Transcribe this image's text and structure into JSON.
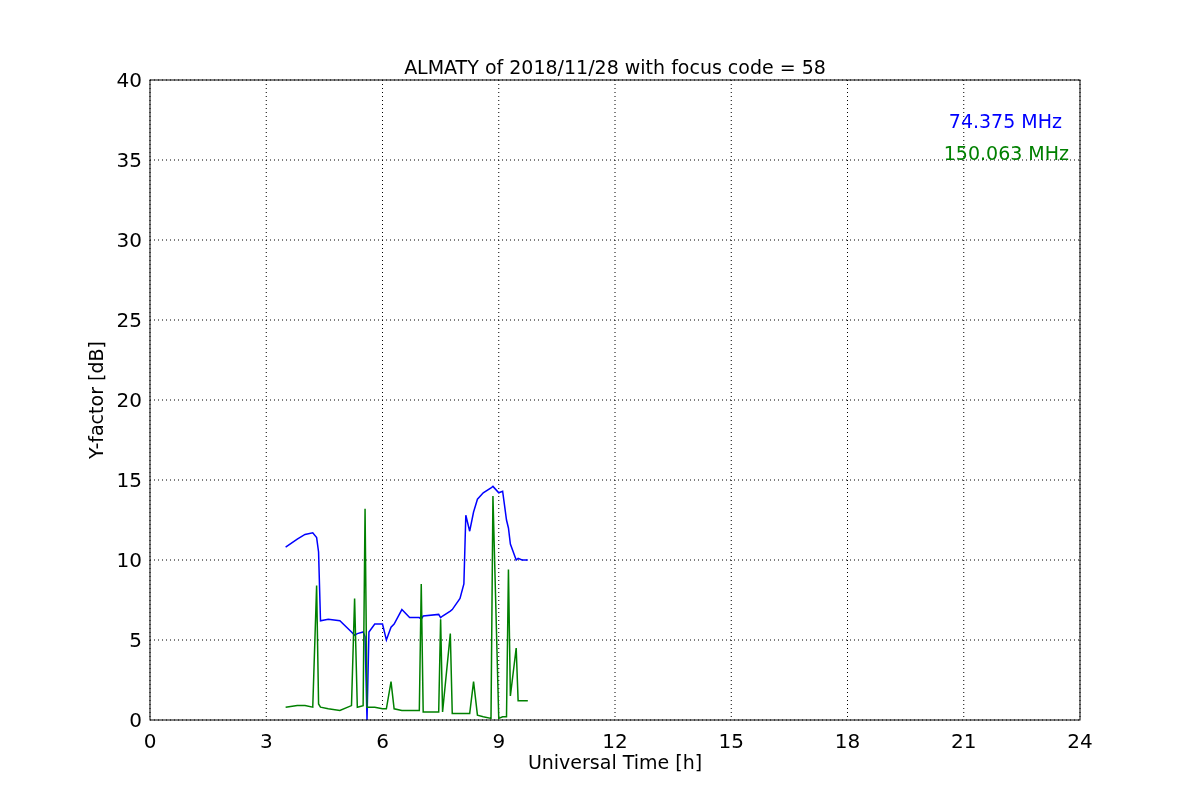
{
  "chart_data": {
    "type": "line",
    "title": "ALMATY of 2018/11/28 with focus code = 58",
    "xlabel": "Universal Time [h]",
    "ylabel": "Y-factor [dB]",
    "x": [
      3.5,
      3.8,
      4.0,
      4.2,
      4.3,
      4.35,
      4.4,
      4.6,
      4.9,
      5.2,
      5.28,
      5.35,
      5.5,
      5.55,
      5.6,
      5.65,
      5.8,
      6.0,
      6.1,
      6.22,
      6.3,
      6.5,
      6.7,
      6.95,
      7.0,
      7.05,
      7.45,
      7.5,
      7.55,
      7.75,
      7.8,
      8.0,
      8.1,
      8.15,
      8.25,
      8.35,
      8.45,
      8.6,
      8.8,
      8.85,
      9.0,
      9.1,
      9.2,
      9.25,
      9.3,
      9.45,
      9.5,
      9.6,
      9.75
    ],
    "series": [
      {
        "name": "74.375 MHz",
        "color": "#0000ff",
        "values": [
          10.8,
          11.3,
          11.6,
          11.7,
          11.4,
          10.5,
          6.2,
          6.3,
          6.2,
          5.5,
          5.3,
          5.4,
          5.5,
          5.2,
          0,
          5.5,
          6.0,
          6.0,
          5.0,
          5.8,
          6.0,
          6.9,
          6.4,
          6.4,
          6.3,
          6.5,
          6.6,
          6.4,
          6.5,
          6.8,
          6.9,
          7.6,
          8.5,
          12.8,
          11.8,
          13.0,
          13.8,
          14.2,
          14.5,
          14.6,
          14.2,
          14.3,
          12.5,
          12.0,
          11.0,
          10.0,
          10.1,
          10.0,
          10.0
        ]
      },
      {
        "name": "150.063 MHz",
        "color": "#008000",
        "values": [
          0.8,
          0.9,
          0.9,
          0.8,
          8.4,
          1.0,
          0.8,
          0.7,
          0.6,
          0.9,
          7.6,
          0.8,
          0.9,
          13.2,
          0.8,
          0.8,
          0.8,
          0.7,
          0.7,
          2.4,
          0.7,
          0.6,
          0.6,
          0.6,
          8.5,
          0.5,
          0.5,
          6.3,
          0.5,
          5.4,
          0.4,
          0.4,
          0.4,
          0.4,
          0.4,
          2.4,
          0.3,
          0.2,
          0.1,
          14.0,
          0.1,
          0.2,
          0.2,
          9.4,
          1.5,
          4.5,
          1.2,
          1.2,
          1.2
        ]
      }
    ],
    "xlim": [
      0,
      24
    ],
    "ylim": [
      0,
      40
    ],
    "xticks": [
      0,
      3,
      6,
      9,
      12,
      15,
      18,
      21,
      24
    ],
    "yticks": [
      0,
      5,
      10,
      15,
      20,
      25,
      30,
      35,
      40
    ],
    "grid": true
  }
}
